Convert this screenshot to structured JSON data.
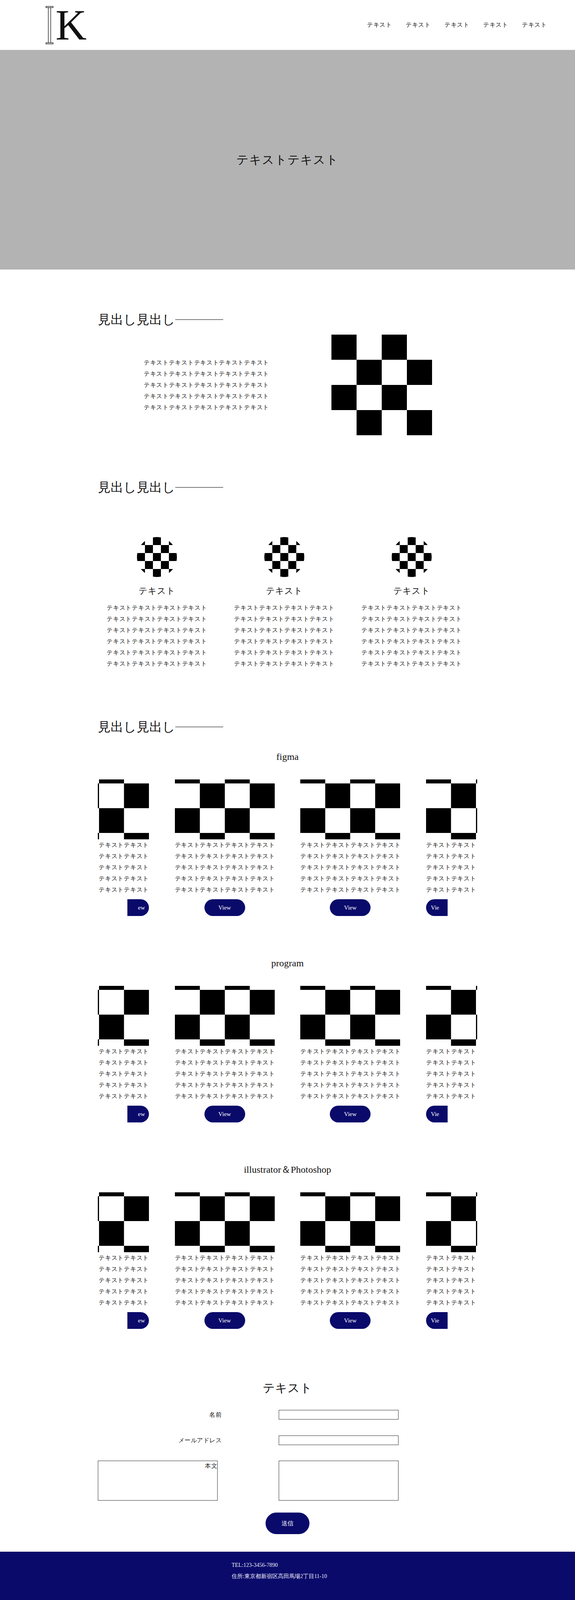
{
  "header": {
    "logo": "K",
    "nav": [
      "テキスト",
      "テキスト",
      "テキスト",
      "テキスト",
      "テキスト"
    ]
  },
  "hero": {
    "title": "テキストテキスト"
  },
  "about": {
    "heading": "見出し見出し",
    "lines": [
      "テキストテキストテキストテキストテキスト",
      "テキストテキストテキストテキストテキスト",
      "テキストテキストテキストテキストテキスト",
      "テキストテキストテキストテキストテキスト",
      "テキストテキストテキストテキストテキスト"
    ]
  },
  "features": {
    "heading": "見出し見出し",
    "items": [
      {
        "title": "テキスト",
        "lines": [
          "テキストテキストテキストテキスト",
          "テキストテキストテキストテキスト",
          "テキストテキストテキストテキスト",
          "テキストテキストテキストテキスト",
          "テキストテキストテキストテキスト",
          "テキストテキストテキストテキスト"
        ]
      },
      {
        "title": "テキスト",
        "lines": [
          "テキストテキストテキストテキスト",
          "テキストテキストテキストテキスト",
          "テキストテキストテキストテキスト",
          "テキストテキストテキストテキスト",
          "テキストテキストテキストテキスト",
          "テキストテキストテキストテキスト"
        ]
      },
      {
        "title": "テキスト",
        "lines": [
          "テキストテキストテキストテキスト",
          "テキストテキストテキストテキスト",
          "テキストテキストテキストテキスト",
          "テキストテキストテキストテキスト",
          "テキストテキストテキストテキスト",
          "テキストテキストテキストテキスト"
        ]
      }
    ]
  },
  "works": {
    "heading": "見出し見出し",
    "categories": [
      {
        "title": "figma",
        "cards": [
          {
            "kind": "clip-left",
            "lines": [
              "テキストテキスト",
              "テキストテキスト",
              "テキストテキスト",
              "テキストテキスト",
              "テキストテキスト"
            ],
            "button": "ew"
          },
          {
            "kind": "full",
            "lines": [
              "テキストテキストテキストテキスト",
              "テキストテキストテキストテキスト",
              "テキストテキストテキストテキスト",
              "テキストテキストテキストテキスト",
              "テキストテキストテキストテキスト"
            ],
            "button": "View"
          },
          {
            "kind": "full",
            "lines": [
              "テキストテキストテキストテキスト",
              "テキストテキストテキストテキスト",
              "テキストテキストテキストテキスト",
              "テキストテキストテキストテキスト",
              "テキストテキストテキストテキスト"
            ],
            "button": "View"
          },
          {
            "kind": "clip-right",
            "lines": [
              "テキストテキスト",
              "テキストテキスト",
              "テキストテキスト",
              "テキストテキスト",
              "テキストテキスト"
            ],
            "button": "Vie"
          }
        ]
      },
      {
        "title": "program",
        "cards": [
          {
            "kind": "clip-left",
            "lines": [
              "テキストテキスト",
              "テキストテキスト",
              "テキストテキスト",
              "テキストテキスト",
              "テキストテキスト"
            ],
            "button": "ew"
          },
          {
            "kind": "full",
            "lines": [
              "テキストテキストテキストテキスト",
              "テキストテキストテキストテキスト",
              "テキストテキストテキストテキスト",
              "テキストテキストテキストテキスト",
              "テキストテキストテキストテキスト"
            ],
            "button": "View"
          },
          {
            "kind": "full",
            "lines": [
              "テキストテキストテキストテキスト",
              "テキストテキストテキストテキスト",
              "テキストテキストテキストテキスト",
              "テキストテキストテキストテキスト",
              "テキストテキストテキストテキスト"
            ],
            "button": "View"
          },
          {
            "kind": "clip-right",
            "lines": [
              "テキストテキスト",
              "テキストテキスト",
              "テキストテキスト",
              "テキストテキスト",
              "テキストテキスト"
            ],
            "button": "Vie"
          }
        ]
      },
      {
        "title": "illustrator＆Photoshop",
        "cards": [
          {
            "kind": "clip-left",
            "lines": [
              "テキストテキスト",
              "テキストテキスト",
              "テキストテキスト",
              "テキストテキスト",
              "テキストテキスト"
            ],
            "button": "ew"
          },
          {
            "kind": "full",
            "lines": [
              "テキストテキストテキストテキスト",
              "テキストテキストテキストテキスト",
              "テキストテキストテキストテキスト",
              "テキストテキストテキストテキスト",
              "テキストテキストテキストテキスト"
            ],
            "button": "View"
          },
          {
            "kind": "full",
            "lines": [
              "テキストテキストテキストテキスト",
              "テキストテキストテキストテキスト",
              "テキストテキストテキストテキスト",
              "テキストテキストテキストテキスト",
              "テキストテキストテキストテキスト"
            ],
            "button": "View"
          },
          {
            "kind": "clip-right",
            "lines": [
              "テキストテキスト",
              "テキストテキスト",
              "テキストテキスト",
              "テキストテキスト",
              "テキストテキスト"
            ],
            "button": "Vie"
          }
        ]
      }
    ]
  },
  "contact": {
    "title": "テキスト",
    "fields": [
      {
        "label": "名前",
        "kind": "text"
      },
      {
        "label": "メールアドレス",
        "kind": "text"
      },
      {
        "label": "本文",
        "kind": "textarea"
      }
    ],
    "submit": "送信"
  },
  "footer": {
    "lines": [
      "TEL:123-3456-7890",
      "住所:東京都新宿区高田馬場2丁目11-10"
    ]
  }
}
